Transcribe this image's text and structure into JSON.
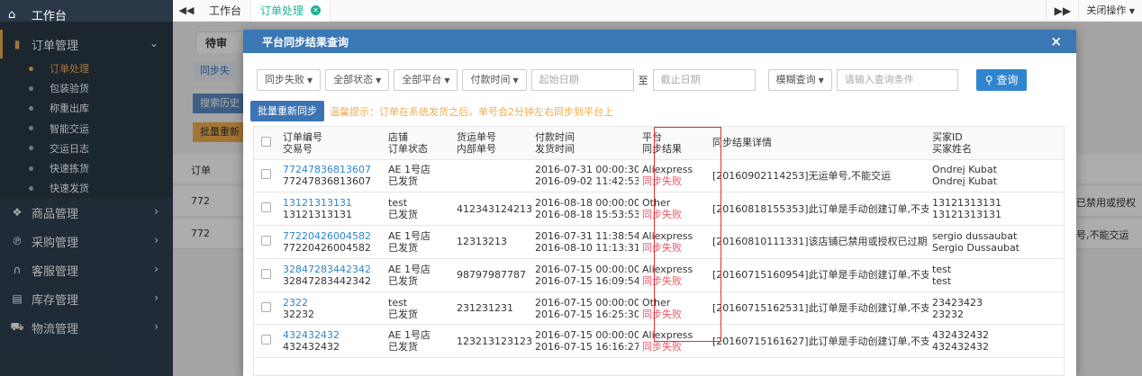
{
  "sidebar": {
    "top": "工作台",
    "groups": [
      {
        "label": "订单管理",
        "expanded": true
      },
      {
        "label": "商品管理"
      },
      {
        "label": "采购管理"
      },
      {
        "label": "客服管理"
      },
      {
        "label": "库存管理"
      },
      {
        "label": "物流管理"
      }
    ],
    "order_items": [
      "订单处理",
      "包装验货",
      "称重出库",
      "智能交运",
      "交运日志",
      "快速拣货",
      "快速发货"
    ],
    "active_item": "订单处理"
  },
  "topbar": {
    "tabs": [
      "工作台",
      "订单处理"
    ],
    "close_ops": "关闭操作"
  },
  "background": {
    "tab_partial": "待审",
    "step_partial": "同步失",
    "search_partial": "搜索历史",
    "bulk_partial": "批量重新",
    "row_partials": [
      "订单",
      "772",
      "772"
    ],
    "right_texts": [
      "已禁用或授权",
      "号,不能交运"
    ]
  },
  "modal": {
    "title": "平台同步结果查询",
    "filters": {
      "status": "同步失败",
      "all_status": "全部状态",
      "all_platform": "全部平台",
      "time_type": "付款时间",
      "start_placeholder": "起始日期",
      "to": "至",
      "end_placeholder": "截止日期",
      "fuzzy": "模糊查询",
      "query_placeholder": "请输入查询条件",
      "search_btn": "查询"
    },
    "bulk_button": "批量重新同步",
    "tip": "温馨提示：订单在系统发货之后，单号会2分钟左右同步到平台上",
    "columns": [
      [
        "订单编号",
        "交易号"
      ],
      [
        "店铺",
        "订单状态"
      ],
      [
        "货运单号",
        "内部单号"
      ],
      [
        "付款时间",
        "发货时间"
      ],
      [
        "平台",
        "同步结果"
      ],
      [
        "同步结果详情",
        ""
      ],
      [
        "买家ID",
        "买家姓名"
      ]
    ],
    "rows": [
      {
        "order": "77247836813607",
        "trade": "77247836813607",
        "shop": "AE 1号店",
        "status": "已发货",
        "tracking": "",
        "pay": "2016-07-31 00:00:30",
        "ship": "2016-09-02 11:42:53",
        "platform": "Aliexpress",
        "result": "同步失败",
        "detail": "[20160902114253]无运单号,不能交运",
        "buyer_id": "Ondrej Kubat",
        "buyer_name": "Ondrej Kubat"
      },
      {
        "order": "13121313131",
        "trade": "13121313131",
        "shop": "test",
        "status": "已发货",
        "tracking": "4123431242134",
        "pay": "2016-08-18 00:00:00",
        "ship": "2016-08-18 15:53:53",
        "platform": "Other",
        "result": "同步失败",
        "detail": "[20160818155353]此订单是手动创建订单,不支",
        "buyer_id": "13121313131",
        "buyer_name": "13121313131"
      },
      {
        "order": "77220426004582",
        "trade": "77220426004582",
        "shop": "AE 1号店",
        "status": "已发货",
        "tracking": "12313213",
        "pay": "2016-07-31 11:38:54",
        "ship": "2016-08-10 11:13:31",
        "platform": "Aliexpress",
        "result": "同步失败",
        "detail": "[20160810111331]该店铺已禁用或授权已过期",
        "buyer_id": "sergio dussaubat",
        "buyer_name": "Sergio Dussaubat"
      },
      {
        "order": "32847283442342",
        "trade": "32847283442342",
        "shop": "AE 1号店",
        "status": "已发货",
        "tracking": "98797987787",
        "pay": "2016-07-15 00:00:00",
        "ship": "2016-07-15 16:09:54",
        "platform": "Aliexpress",
        "result": "同步失败",
        "detail": "[20160715160954]此订单是手动创建订单,不支",
        "buyer_id": "test",
        "buyer_name": "test"
      },
      {
        "order": "2322",
        "trade": "32232",
        "shop": "test",
        "status": "已发货",
        "tracking": "231231231",
        "pay": "2016-07-15 00:00:00",
        "ship": "2016-07-15 16:25:30",
        "platform": "Other",
        "result": "同步失败",
        "detail": "[20160715162531]此订单是手动创建订单,不支",
        "buyer_id": "23423423",
        "buyer_name": "23232"
      },
      {
        "order": "432432432",
        "trade": "432432432",
        "shop": "AE 1号店",
        "status": "已发货",
        "tracking": "12321312312312",
        "pay": "2016-07-15 00:00:00",
        "ship": "2016-07-15 16:16:27",
        "platform": "Aliexpress",
        "result": "同步失败",
        "detail": "[20160715161627]此订单是手动创建订单,不支",
        "buyer_id": "432432432",
        "buyer_name": "432432432"
      }
    ]
  }
}
